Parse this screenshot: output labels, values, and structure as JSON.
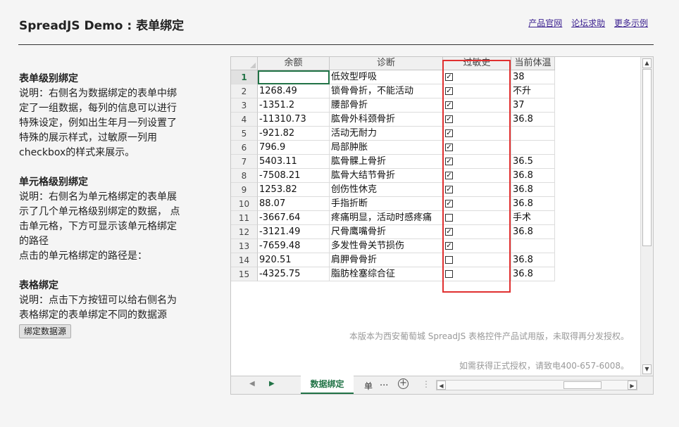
{
  "header": {
    "title": "SpreadJS Demo : 表单绑定",
    "links": [
      "产品官网",
      "论坛求助",
      "更多示例"
    ]
  },
  "left": {
    "sections": [
      {
        "heading": "表单级别绑定",
        "lines": [
          "说明：右侧名为数据绑定的表单中绑",
          "定了一组数据，每列的信息可以进行",
          "特殊设定，例如出生年月一列设置了",
          "特殊的展示样式，过敏原一列用",
          "checkbox的样式来展示。"
        ]
      },
      {
        "heading": "单元格级别绑定",
        "lines": [
          "说明：右侧名为单元格绑定的表单展",
          "示了几个单元格级别绑定的数据， 点",
          "击单元格，下方可显示该单元格绑定",
          "的路径",
          "点击的单元格绑定的路径是："
        ]
      },
      {
        "heading": "表格绑定",
        "lines": [
          "说明：点击下方按钮可以给右侧名为",
          "表格绑定的表单绑定不同的数据源"
        ]
      }
    ],
    "button_label": "绑定数据源"
  },
  "sheet": {
    "columns": [
      "余额",
      "诊断",
      "过敏史",
      "当前体温"
    ],
    "rows": [
      {
        "n": "1",
        "balance": "",
        "diagnosis": "低效型呼吸",
        "allergy": true,
        "temp": "38"
      },
      {
        "n": "2",
        "balance": "1268.49",
        "diagnosis": "锁骨骨折，不能活动",
        "allergy": true,
        "temp": "不升"
      },
      {
        "n": "3",
        "balance": "-1351.2",
        "diagnosis": "腰部骨折",
        "allergy": true,
        "temp": "37"
      },
      {
        "n": "4",
        "balance": "-11310.73",
        "diagnosis": "肱骨外科颈骨折",
        "allergy": true,
        "temp": "36.8"
      },
      {
        "n": "5",
        "balance": "-921.82",
        "diagnosis": "活动无耐力",
        "allergy": true,
        "temp": ""
      },
      {
        "n": "6",
        "balance": "796.9",
        "diagnosis": "局部肿胀",
        "allergy": true,
        "temp": ""
      },
      {
        "n": "7",
        "balance": "5403.11",
        "diagnosis": "肱骨髁上骨折",
        "allergy": true,
        "temp": "36.5"
      },
      {
        "n": "8",
        "balance": "-7508.21",
        "diagnosis": "肱骨大结节骨折",
        "allergy": true,
        "temp": "36.8"
      },
      {
        "n": "9",
        "balance": "1253.82",
        "diagnosis": "创伤性休克",
        "allergy": true,
        "temp": "36.8"
      },
      {
        "n": "10",
        "balance": "88.07",
        "diagnosis": "手指折断",
        "allergy": true,
        "temp": "36.8"
      },
      {
        "n": "11",
        "balance": "-3667.64",
        "diagnosis": "疼痛明显，活动时感疼痛",
        "allergy": false,
        "temp": "手术"
      },
      {
        "n": "12",
        "balance": "-3121.49",
        "diagnosis": "尺骨鹰嘴骨折",
        "allergy": true,
        "temp": "36.8"
      },
      {
        "n": "13",
        "balance": "-7659.48",
        "diagnosis": "多发性骨关节损伤",
        "allergy": true,
        "temp": ""
      },
      {
        "n": "14",
        "balance": "920.51",
        "diagnosis": "肩胛骨骨折",
        "allergy": false,
        "temp": "36.8"
      },
      {
        "n": "15",
        "balance": "-4325.75",
        "diagnosis": "脂肪栓塞综合征",
        "allergy": false,
        "temp": "36.8"
      }
    ],
    "notice_line1": "本版本为西安葡萄城 SpreadJS 表格控件产品试用版，未取得再分发授权。",
    "notice_line2": "如需获得正式授权，请致电400-657-6008。",
    "tabs": {
      "active": "数据绑定",
      "second": "单",
      "more": "..."
    }
  },
  "colors": {
    "accent_green": "#217346",
    "highlight_red": "#e03030",
    "link": "#3a1f8f"
  }
}
